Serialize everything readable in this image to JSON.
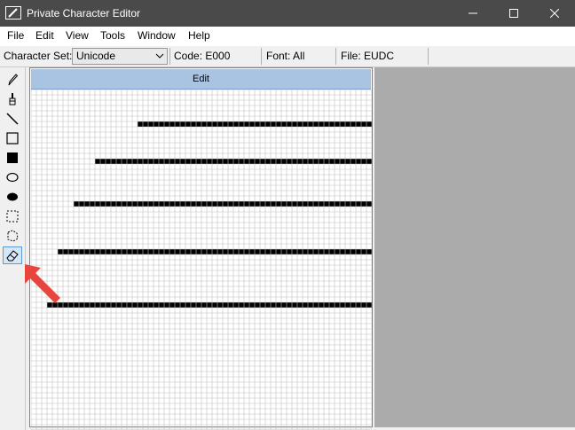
{
  "window": {
    "title": "Private Character Editor"
  },
  "menu": [
    "File",
    "Edit",
    "View",
    "Tools",
    "Window",
    "Help"
  ],
  "info": {
    "charset_label": "Character Set:",
    "charset_value": "Unicode",
    "code": "Code: E000",
    "font": "Font: All",
    "file": "File: EUDC"
  },
  "editor": {
    "title": "Edit"
  },
  "tools": [
    {
      "name": "pencil-icon"
    },
    {
      "name": "brush-icon"
    },
    {
      "name": "line-icon"
    },
    {
      "name": "hollow-rectangle-icon"
    },
    {
      "name": "filled-rectangle-icon"
    },
    {
      "name": "hollow-ellipse-icon"
    },
    {
      "name": "filled-ellipse-icon"
    },
    {
      "name": "rectangular-selection-icon"
    },
    {
      "name": "freeform-selection-icon"
    },
    {
      "name": "eraser-icon",
      "active": true
    }
  ],
  "colors": {
    "titlebar": "#4a4a4a",
    "editor_header": "#a9c4e2",
    "pixel": "#000000",
    "grid": "#c0c0c0",
    "arrow": "#e8453c"
  },
  "grid": {
    "cols": 64,
    "rows": 64,
    "pixels": [
      [
        20,
        6
      ],
      [
        21,
        6
      ],
      [
        22,
        6
      ],
      [
        23,
        6
      ],
      [
        24,
        6
      ],
      [
        25,
        6
      ],
      [
        26,
        6
      ],
      [
        27,
        6
      ],
      [
        28,
        6
      ],
      [
        29,
        6
      ],
      [
        30,
        6
      ],
      [
        31,
        6
      ],
      [
        32,
        6
      ],
      [
        33,
        6
      ],
      [
        34,
        6
      ],
      [
        35,
        6
      ],
      [
        36,
        6
      ],
      [
        37,
        6
      ],
      [
        38,
        6
      ],
      [
        39,
        6
      ],
      [
        40,
        6
      ],
      [
        41,
        6
      ],
      [
        42,
        6
      ],
      [
        43,
        6
      ],
      [
        44,
        6
      ],
      [
        45,
        6
      ],
      [
        46,
        6
      ],
      [
        47,
        6
      ],
      [
        48,
        6
      ],
      [
        49,
        6
      ],
      [
        50,
        6
      ],
      [
        51,
        6
      ],
      [
        52,
        6
      ],
      [
        53,
        6
      ],
      [
        54,
        6
      ],
      [
        55,
        6
      ],
      [
        56,
        6
      ],
      [
        57,
        6
      ],
      [
        58,
        6
      ],
      [
        59,
        6
      ],
      [
        60,
        6
      ],
      [
        61,
        6
      ],
      [
        62,
        6
      ],
      [
        63,
        6
      ],
      [
        12,
        13
      ],
      [
        13,
        13
      ],
      [
        14,
        13
      ],
      [
        15,
        13
      ],
      [
        16,
        13
      ],
      [
        17,
        13
      ],
      [
        18,
        13
      ],
      [
        19,
        13
      ],
      [
        20,
        13
      ],
      [
        21,
        13
      ],
      [
        22,
        13
      ],
      [
        23,
        13
      ],
      [
        24,
        13
      ],
      [
        25,
        13
      ],
      [
        26,
        13
      ],
      [
        27,
        13
      ],
      [
        28,
        13
      ],
      [
        29,
        13
      ],
      [
        30,
        13
      ],
      [
        31,
        13
      ],
      [
        32,
        13
      ],
      [
        33,
        13
      ],
      [
        34,
        13
      ],
      [
        35,
        13
      ],
      [
        36,
        13
      ],
      [
        37,
        13
      ],
      [
        38,
        13
      ],
      [
        39,
        13
      ],
      [
        40,
        13
      ],
      [
        41,
        13
      ],
      [
        42,
        13
      ],
      [
        43,
        13
      ],
      [
        44,
        13
      ],
      [
        45,
        13
      ],
      [
        46,
        13
      ],
      [
        47,
        13
      ],
      [
        48,
        13
      ],
      [
        49,
        13
      ],
      [
        50,
        13
      ],
      [
        51,
        13
      ],
      [
        52,
        13
      ],
      [
        53,
        13
      ],
      [
        54,
        13
      ],
      [
        55,
        13
      ],
      [
        56,
        13
      ],
      [
        57,
        13
      ],
      [
        58,
        13
      ],
      [
        59,
        13
      ],
      [
        60,
        13
      ],
      [
        61,
        13
      ],
      [
        62,
        13
      ],
      [
        63,
        13
      ],
      [
        8,
        21
      ],
      [
        9,
        21
      ],
      [
        10,
        21
      ],
      [
        11,
        21
      ],
      [
        12,
        21
      ],
      [
        13,
        21
      ],
      [
        14,
        21
      ],
      [
        15,
        21
      ],
      [
        16,
        21
      ],
      [
        17,
        21
      ],
      [
        18,
        21
      ],
      [
        19,
        21
      ],
      [
        20,
        21
      ],
      [
        21,
        21
      ],
      [
        22,
        21
      ],
      [
        23,
        21
      ],
      [
        24,
        21
      ],
      [
        25,
        21
      ],
      [
        26,
        21
      ],
      [
        27,
        21
      ],
      [
        28,
        21
      ],
      [
        29,
        21
      ],
      [
        30,
        21
      ],
      [
        31,
        21
      ],
      [
        32,
        21
      ],
      [
        33,
        21
      ],
      [
        34,
        21
      ],
      [
        35,
        21
      ],
      [
        36,
        21
      ],
      [
        37,
        21
      ],
      [
        38,
        21
      ],
      [
        39,
        21
      ],
      [
        40,
        21
      ],
      [
        41,
        21
      ],
      [
        42,
        21
      ],
      [
        43,
        21
      ],
      [
        44,
        21
      ],
      [
        45,
        21
      ],
      [
        46,
        21
      ],
      [
        47,
        21
      ],
      [
        48,
        21
      ],
      [
        49,
        21
      ],
      [
        50,
        21
      ],
      [
        51,
        21
      ],
      [
        52,
        21
      ],
      [
        53,
        21
      ],
      [
        54,
        21
      ],
      [
        55,
        21
      ],
      [
        56,
        21
      ],
      [
        57,
        21
      ],
      [
        58,
        21
      ],
      [
        59,
        21
      ],
      [
        60,
        21
      ],
      [
        61,
        21
      ],
      [
        62,
        21
      ],
      [
        63,
        21
      ],
      [
        5,
        30
      ],
      [
        6,
        30
      ],
      [
        7,
        30
      ],
      [
        8,
        30
      ],
      [
        9,
        30
      ],
      [
        10,
        30
      ],
      [
        11,
        30
      ],
      [
        12,
        30
      ],
      [
        13,
        30
      ],
      [
        14,
        30
      ],
      [
        15,
        30
      ],
      [
        16,
        30
      ],
      [
        17,
        30
      ],
      [
        18,
        30
      ],
      [
        19,
        30
      ],
      [
        20,
        30
      ],
      [
        21,
        30
      ],
      [
        22,
        30
      ],
      [
        23,
        30
      ],
      [
        24,
        30
      ],
      [
        25,
        30
      ],
      [
        26,
        30
      ],
      [
        27,
        30
      ],
      [
        28,
        30
      ],
      [
        29,
        30
      ],
      [
        30,
        30
      ],
      [
        31,
        30
      ],
      [
        32,
        30
      ],
      [
        33,
        30
      ],
      [
        34,
        30
      ],
      [
        35,
        30
      ],
      [
        36,
        30
      ],
      [
        37,
        30
      ],
      [
        38,
        30
      ],
      [
        39,
        30
      ],
      [
        40,
        30
      ],
      [
        41,
        30
      ],
      [
        42,
        30
      ],
      [
        43,
        30
      ],
      [
        44,
        30
      ],
      [
        45,
        30
      ],
      [
        46,
        30
      ],
      [
        47,
        30
      ],
      [
        48,
        30
      ],
      [
        49,
        30
      ],
      [
        50,
        30
      ],
      [
        51,
        30
      ],
      [
        52,
        30
      ],
      [
        53,
        30
      ],
      [
        54,
        30
      ],
      [
        55,
        30
      ],
      [
        56,
        30
      ],
      [
        57,
        30
      ],
      [
        58,
        30
      ],
      [
        59,
        30
      ],
      [
        60,
        30
      ],
      [
        61,
        30
      ],
      [
        62,
        30
      ],
      [
        63,
        30
      ],
      [
        3,
        40
      ],
      [
        4,
        40
      ],
      [
        5,
        40
      ],
      [
        6,
        40
      ],
      [
        7,
        40
      ],
      [
        8,
        40
      ],
      [
        9,
        40
      ],
      [
        10,
        40
      ],
      [
        11,
        40
      ],
      [
        12,
        40
      ],
      [
        13,
        40
      ],
      [
        14,
        40
      ],
      [
        15,
        40
      ],
      [
        16,
        40
      ],
      [
        17,
        40
      ],
      [
        18,
        40
      ],
      [
        19,
        40
      ],
      [
        20,
        40
      ],
      [
        21,
        40
      ],
      [
        22,
        40
      ],
      [
        23,
        40
      ],
      [
        24,
        40
      ],
      [
        25,
        40
      ],
      [
        26,
        40
      ],
      [
        27,
        40
      ],
      [
        28,
        40
      ],
      [
        29,
        40
      ],
      [
        30,
        40
      ],
      [
        31,
        40
      ],
      [
        32,
        40
      ],
      [
        33,
        40
      ],
      [
        34,
        40
      ],
      [
        35,
        40
      ],
      [
        36,
        40
      ],
      [
        37,
        40
      ],
      [
        38,
        40
      ],
      [
        39,
        40
      ],
      [
        40,
        40
      ],
      [
        41,
        40
      ],
      [
        42,
        40
      ],
      [
        43,
        40
      ],
      [
        44,
        40
      ],
      [
        45,
        40
      ],
      [
        46,
        40
      ],
      [
        47,
        40
      ],
      [
        48,
        40
      ],
      [
        49,
        40
      ],
      [
        50,
        40
      ],
      [
        51,
        40
      ],
      [
        52,
        40
      ],
      [
        53,
        40
      ],
      [
        54,
        40
      ],
      [
        55,
        40
      ],
      [
        56,
        40
      ],
      [
        57,
        40
      ],
      [
        58,
        40
      ],
      [
        59,
        40
      ],
      [
        60,
        40
      ],
      [
        61,
        40
      ],
      [
        62,
        40
      ],
      [
        63,
        40
      ]
    ]
  }
}
